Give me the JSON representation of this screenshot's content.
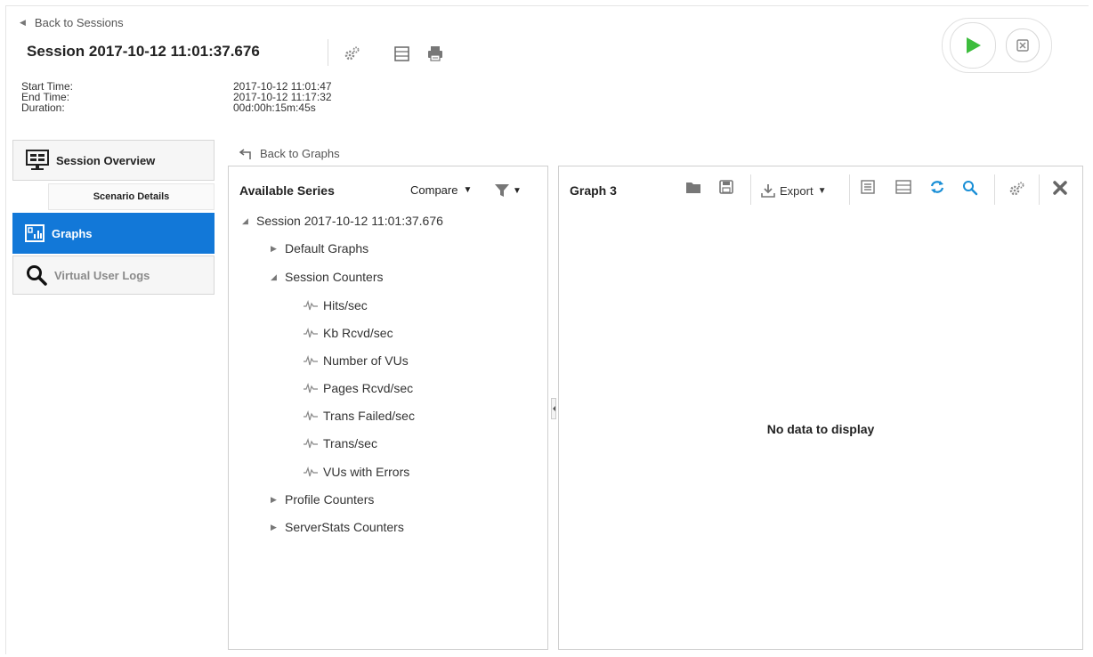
{
  "nav_back_sessions": "Back to Sessions",
  "session": {
    "title": "Session 2017-10-12 11:01:37.676",
    "meta_labels": [
      "Start Time:",
      "End Time:",
      "Duration:"
    ],
    "meta_values": [
      "2017-10-12 11:01:47",
      "2017-10-12 11:17:32",
      "00d:00h:15m:45s"
    ]
  },
  "sidebar": {
    "overview": "Session Overview",
    "scenario": "Scenario Details",
    "graphs": "Graphs",
    "logs": "Virtual User Logs"
  },
  "back_graphs": "Back to Graphs",
  "series_panel": {
    "title": "Available Series",
    "compare": "Compare",
    "root": "Session 2017-10-12 11:01:37.676",
    "default_graphs": "Default Graphs",
    "session_counters": "Session Counters",
    "counters": [
      "Hits/sec",
      "Kb Rcvd/sec",
      "Number of VUs",
      "Pages Rcvd/sec",
      "Trans Failed/sec",
      "Trans/sec",
      "VUs with Errors"
    ],
    "profile_counters": "Profile Counters",
    "serverstats_counters": "ServerStats Counters"
  },
  "graph_panel": {
    "title": "Graph 3",
    "export": "Export",
    "empty_message": "No data to display"
  },
  "colors": {
    "accent": "#1278d8",
    "play": "#3dbd3d",
    "refresh": "#1a8fd6"
  }
}
